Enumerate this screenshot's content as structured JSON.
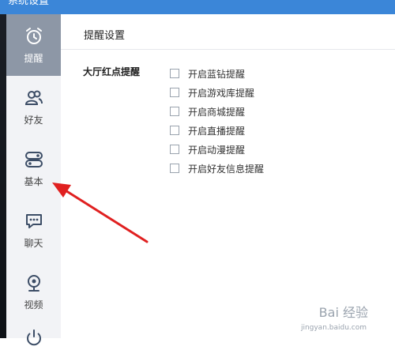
{
  "window": {
    "title": "系统设置"
  },
  "sidebar": {
    "items": [
      {
        "label": "提醒",
        "icon": "alarm-clock-icon",
        "active": true
      },
      {
        "label": "好友",
        "icon": "friends-icon",
        "active": false
      },
      {
        "label": "基本",
        "icon": "toggle-settings-icon",
        "active": false
      },
      {
        "label": "聊天",
        "icon": "chat-bubble-icon",
        "active": false
      },
      {
        "label": "视频",
        "icon": "webcam-icon",
        "active": false
      }
    ]
  },
  "main": {
    "section_title": "提醒设置",
    "group_label": "大厅红点提醒",
    "options": [
      {
        "label": "开启蓝钻提醒",
        "checked": false
      },
      {
        "label": "开启游戏库提醒",
        "checked": false
      },
      {
        "label": "开启商城提醒",
        "checked": false
      },
      {
        "label": "开启直播提醒",
        "checked": false
      },
      {
        "label": "开启动漫提醒",
        "checked": false
      },
      {
        "label": "开启好友信息提醒",
        "checked": false
      }
    ]
  },
  "watermark": {
    "text": "Bai 经验",
    "sub": "jingyan.baidu.com"
  },
  "colors": {
    "titlebar": "#3b86d8",
    "sidebar_active": "#8d97a6",
    "arrow": "#e02020"
  }
}
